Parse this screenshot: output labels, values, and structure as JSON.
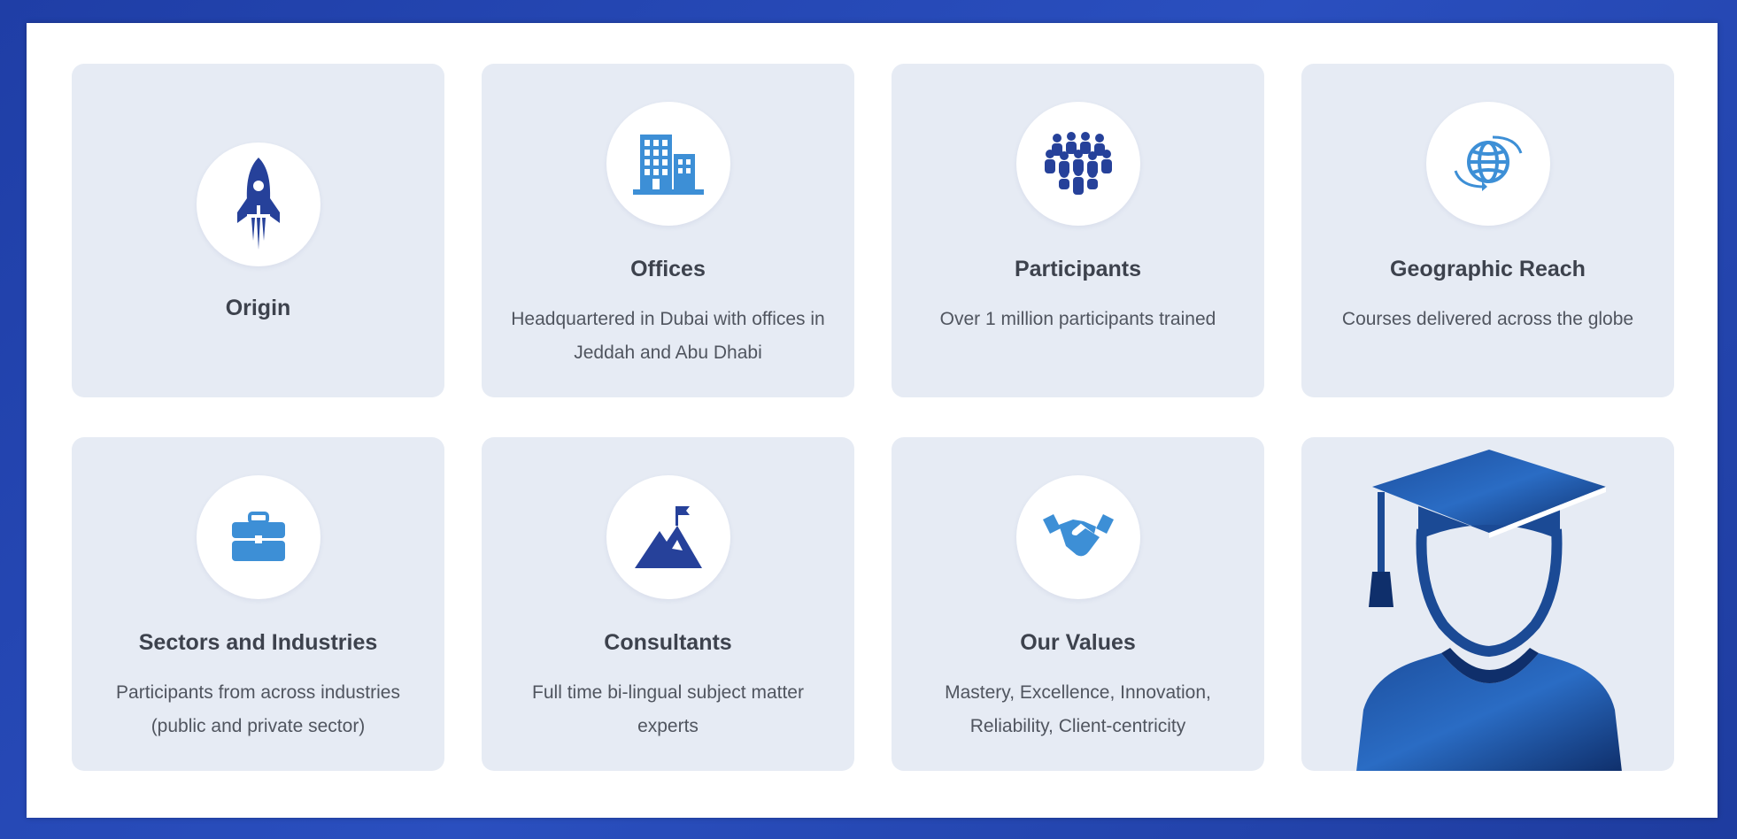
{
  "cards": [
    {
      "title": "Origin",
      "description": "",
      "icon": "rocket-icon"
    },
    {
      "title": "Offices",
      "description": "Headquartered in Dubai with offices in Jeddah and Abu Dhabi",
      "icon": "office-building-icon"
    },
    {
      "title": "Participants",
      "description": "Over 1 million participants trained",
      "icon": "people-group-icon"
    },
    {
      "title": "Geographic Reach",
      "description": "Courses delivered across the globe",
      "icon": "globe-icon"
    },
    {
      "title": "Sectors and Industries",
      "description": "Participants from across industries (public and private sector)",
      "icon": "briefcase-icon"
    },
    {
      "title": "Consultants",
      "description": "Full time bi-lingual subject matter experts",
      "icon": "mountain-flag-icon"
    },
    {
      "title": "Our Values",
      "description": "Mastery, Excellence, Innovation, Reliability, Client-centricity",
      "icon": "handshake-icon"
    }
  ],
  "graduate_card": {
    "icon": "graduate-icon"
  },
  "colors": {
    "frame": "#2347b0",
    "card_bg": "#e6ebf4",
    "icon_dark": "#26419a",
    "icon_light": "#3d8fd6",
    "text": "#4a4f5a"
  }
}
